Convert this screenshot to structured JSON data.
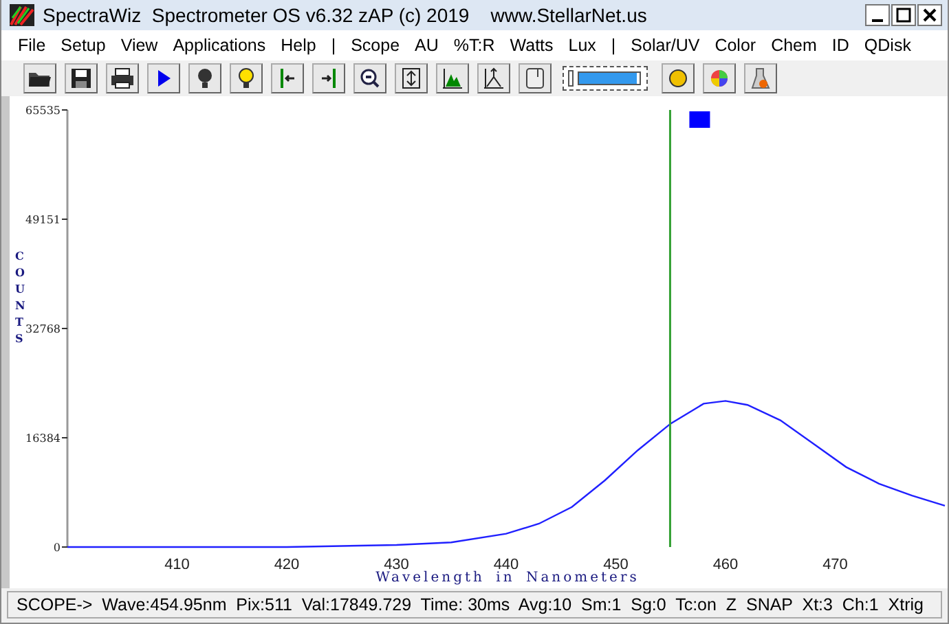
{
  "window": {
    "title": "SpectraWiz  Spectrometer OS v6.32 zAP (c) 2019    www.StellarNet.us"
  },
  "menu": [
    "File",
    "Setup",
    "View",
    "Applications",
    "Help",
    "|",
    "Scope",
    "AU",
    "%T:R",
    "Watts",
    "Lux",
    "|",
    "Solar/UV",
    "Color",
    "Chem",
    "ID",
    "QDisk"
  ],
  "toolbar": {
    "meter": {
      "level": 0.95
    }
  },
  "plot": {
    "chart_data": {
      "type": "line",
      "xlabel": "Wavelength in Nanometers",
      "ylabel": "COUNTS",
      "xlim": [
        400,
        480
      ],
      "ylim": [
        0,
        65535
      ],
      "xticks": [
        410,
        420,
        430,
        440,
        450,
        460,
        470
      ],
      "yticks": [
        0,
        16384,
        32768,
        49151,
        65535
      ],
      "x": [
        400,
        410,
        420,
        430,
        435,
        440,
        443,
        446,
        449,
        452,
        455,
        458,
        460,
        462,
        465,
        468,
        471,
        474,
        477,
        480
      ],
      "series": [
        {
          "color": "#2020ff",
          "values": [
            0,
            0,
            0,
            300,
            700,
            2000,
            3500,
            6000,
            10000,
            14500,
            18500,
            21500,
            21900,
            21300,
            19000,
            15500,
            12000,
            9500,
            7700,
            6200
          ]
        }
      ],
      "ref_lines": [
        {
          "axis": "x",
          "value": 454.95,
          "color": "#33a033"
        }
      ]
    }
  },
  "status_bar": "SCOPE->  Wave:454.95nm  Pix:511  Val:17849.729  Time: 30ms  Avg:10  Sm:1  Sg:0  Tc:on  Z  SNAP  Xt:3  Ch:1  Xtrig"
}
